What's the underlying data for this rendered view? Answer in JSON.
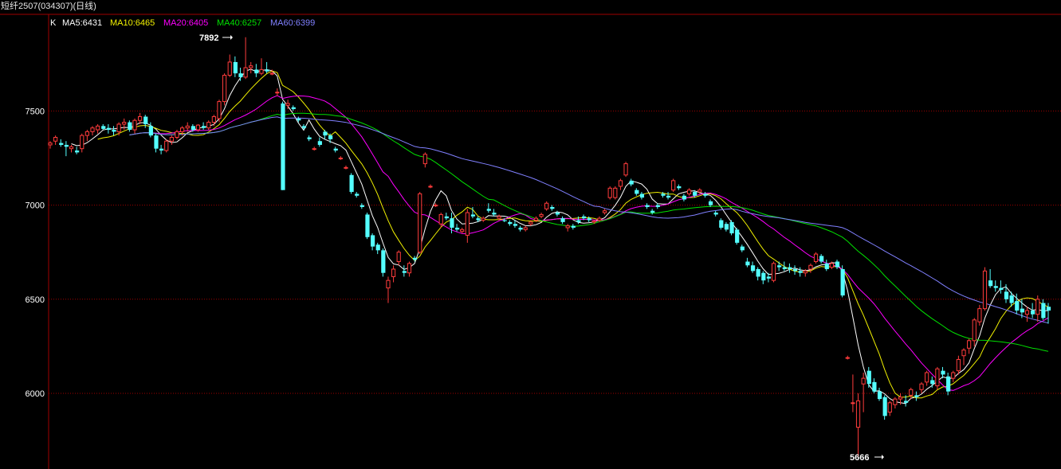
{
  "window_title": "短纤2507(034307)(日线)",
  "legend": {
    "k_label": "K",
    "items": [
      {
        "label": "MA5:6431",
        "color": "#ffffff"
      },
      {
        "label": "MA10:6465",
        "color": "#f0f000"
      },
      {
        "label": "MA20:6405",
        "color": "#ff00ff"
      },
      {
        "label": "MA40:6257",
        "color": "#00e000"
      },
      {
        "label": "MA60:6399",
        "color": "#8080ff"
      }
    ]
  },
  "colors": {
    "up": "#ff3c3c",
    "down": "#54ffff",
    "grid": "#a00000",
    "axis": "#a00000"
  },
  "annotations": {
    "high_label": "7892",
    "low_label": "5666"
  },
  "chart_data": {
    "type": "candlestick",
    "title": "短纤2507(034307)(日线)",
    "y_ticks": [
      6000,
      6500,
      7000,
      7500
    ],
    "ylim": [
      5650,
      7980
    ],
    "grid": true,
    "high": 7892,
    "low": 5666,
    "ma_last": {
      "MA5": 6431,
      "MA10": 6465,
      "MA20": 6405,
      "MA40": 6257,
      "MA60": 6399
    },
    "candles": [
      [
        7320,
        7340,
        7300,
        7330
      ],
      [
        7340,
        7370,
        7320,
        7360
      ],
      [
        7330,
        7350,
        7310,
        7320
      ],
      [
        7320,
        7340,
        7260,
        7310
      ],
      [
        7300,
        7320,
        7280,
        7310
      ],
      [
        7290,
        7310,
        7270,
        7280
      ],
      [
        7300,
        7380,
        7280,
        7370
      ],
      [
        7370,
        7400,
        7340,
        7390
      ],
      [
        7390,
        7420,
        7370,
        7410
      ],
      [
        7400,
        7430,
        7380,
        7420
      ],
      [
        7420,
        7430,
        7400,
        7405
      ],
      [
        7410,
        7430,
        7380,
        7400
      ],
      [
        7400,
        7420,
        7370,
        7390
      ],
      [
        7390,
        7440,
        7370,
        7430
      ],
      [
        7430,
        7460,
        7400,
        7440
      ],
      [
        7440,
        7450,
        7390,
        7400
      ],
      [
        7400,
        7460,
        7380,
        7450
      ],
      [
        7450,
        7490,
        7430,
        7470
      ],
      [
        7470,
        7480,
        7410,
        7430
      ],
      [
        7420,
        7440,
        7360,
        7370
      ],
      [
        7370,
        7380,
        7280,
        7300
      ],
      [
        7300,
        7320,
        7270,
        7290
      ],
      [
        7290,
        7350,
        7280,
        7340
      ],
      [
        7340,
        7370,
        7320,
        7360
      ],
      [
        7360,
        7400,
        7350,
        7390
      ],
      [
        7390,
        7420,
        7370,
        7410
      ],
      [
        7410,
        7440,
        7390,
        7420
      ],
      [
        7420,
        7430,
        7390,
        7400
      ],
      [
        7400,
        7430,
        7390,
        7425
      ],
      [
        7420,
        7440,
        7400,
        7410
      ],
      [
        7410,
        7450,
        7400,
        7440
      ],
      [
        7440,
        7480,
        7420,
        7470
      ],
      [
        7460,
        7560,
        7440,
        7550
      ],
      [
        7550,
        7700,
        7530,
        7690
      ],
      [
        7690,
        7800,
        7680,
        7760
      ],
      [
        7760,
        7790,
        7680,
        7700
      ],
      [
        7700,
        7730,
        7660,
        7680
      ],
      [
        7680,
        7892,
        7670,
        7730
      ],
      [
        7730,
        7760,
        7700,
        7740
      ],
      [
        7720,
        7750,
        7680,
        7700
      ],
      [
        7700,
        7780,
        7690,
        7720
      ],
      [
        7720,
        7760,
        7700,
        7710
      ],
      [
        7700,
        7720,
        7690,
        7700
      ],
      [
        7600,
        7620,
        7580,
        7600
      ],
      [
        7540,
        7550,
        7080,
        7080
      ],
      [
        7530,
        7560,
        7510,
        7540
      ],
      [
        7520,
        7530,
        7500,
        7510
      ],
      [
        7460,
        7470,
        7440,
        7450
      ],
      [
        7420,
        7430,
        7400,
        7410
      ],
      [
        7360,
        7370,
        7340,
        7350
      ],
      [
        7300,
        7310,
        7290,
        7300
      ],
      [
        7340,
        7360,
        7310,
        7320
      ],
      [
        7390,
        7400,
        7350,
        7370
      ],
      [
        7370,
        7380,
        7330,
        7350
      ],
      [
        7300,
        7310,
        7280,
        7290
      ],
      [
        7250,
        7260,
        7240,
        7250
      ],
      [
        7200,
        7210,
        7190,
        7200
      ],
      [
        7160,
        7170,
        7060,
        7070
      ],
      [
        7060,
        7070,
        7040,
        7050
      ],
      [
        7000,
        7010,
        6980,
        6990
      ],
      [
        6950,
        6960,
        6820,
        6830
      ],
      [
        6840,
        6850,
        6760,
        6780
      ],
      [
        6790,
        6800,
        6740,
        6760
      ],
      [
        6760,
        6770,
        6620,
        6640
      ],
      [
        6560,
        6620,
        6480,
        6600
      ],
      [
        6620,
        6680,
        6590,
        6660
      ],
      [
        6700,
        6760,
        6680,
        6750
      ],
      [
        6650,
        6680,
        6620,
        6640
      ],
      [
        6640,
        6700,
        6620,
        6690
      ],
      [
        6720,
        6730,
        6700,
        6710
      ],
      [
        6750,
        7070,
        6740,
        7060
      ],
      [
        7220,
        7280,
        7200,
        7270
      ],
      [
        7100,
        7110,
        7090,
        7100
      ],
      [
        7000,
        7010,
        6990,
        7000
      ],
      [
        6900,
        6960,
        6880,
        6950
      ],
      [
        6940,
        6960,
        6920,
        6930
      ],
      [
        6930,
        6960,
        6850,
        6880
      ],
      [
        6880,
        6900,
        6860,
        6870
      ],
      [
        6860,
        6880,
        6850,
        6870
      ],
      [
        6840,
        6980,
        6800,
        6960
      ],
      [
        6950,
        6990,
        6930,
        6940
      ],
      [
        6930,
        6940,
        6910,
        6920
      ],
      [
        6920,
        6940,
        6910,
        6930
      ],
      [
        6980,
        7010,
        6960,
        6970
      ],
      [
        6960,
        6980,
        6940,
        6950
      ],
      [
        6930,
        6950,
        6920,
        6940
      ],
      [
        6920,
        6930,
        6910,
        6915
      ],
      [
        6910,
        6920,
        6890,
        6900
      ],
      [
        6900,
        6920,
        6880,
        6890
      ],
      [
        6880,
        6890,
        6860,
        6870
      ],
      [
        6870,
        6890,
        6860,
        6880
      ],
      [
        6900,
        6920,
        6890,
        6910
      ],
      [
        6920,
        6940,
        6910,
        6930
      ],
      [
        6940,
        6960,
        6930,
        6950
      ],
      [
        6980,
        7020,
        6970,
        7010
      ],
      [
        6990,
        7000,
        6970,
        6980
      ],
      [
        6960,
        6970,
        6940,
        6950
      ],
      [
        6930,
        6940,
        6900,
        6910
      ],
      [
        6880,
        6900,
        6860,
        6890
      ],
      [
        6890,
        6900,
        6870,
        6880
      ],
      [
        6920,
        6940,
        6900,
        6910
      ],
      [
        6940,
        6950,
        6920,
        6930
      ],
      [
        6930,
        6940,
        6910,
        6920
      ],
      [
        6910,
        6920,
        6900,
        6915
      ],
      [
        6920,
        6940,
        6910,
        6930
      ],
      [
        6960,
        6980,
        6950,
        6970
      ],
      [
        7040,
        7100,
        7030,
        7090
      ],
      [
        7040,
        7100,
        7030,
        7090
      ],
      [
        7100,
        7140,
        7080,
        7130
      ],
      [
        7160,
        7230,
        7150,
        7220
      ],
      [
        7130,
        7140,
        7100,
        7110
      ],
      [
        7080,
        7090,
        7050,
        7060
      ],
      [
        7060,
        7070,
        7030,
        7040
      ],
      [
        7000,
        7010,
        6980,
        6990
      ],
      [
        6970,
        6980,
        6950,
        6960
      ],
      [
        7000,
        7010,
        6980,
        6990
      ],
      [
        7060,
        7070,
        7040,
        7050
      ],
      [
        7050,
        7070,
        7030,
        7040
      ],
      [
        7080,
        7140,
        7070,
        7130
      ],
      [
        7100,
        7110,
        7080,
        7090
      ],
      [
        7050,
        7060,
        7020,
        7030
      ],
      [
        7060,
        7090,
        7050,
        7080
      ],
      [
        7070,
        7080,
        7040,
        7050
      ],
      [
        7070,
        7090,
        7060,
        7080
      ],
      [
        7060,
        7070,
        7040,
        7050
      ],
      [
        7020,
        7030,
        6990,
        7000
      ],
      [
        6960,
        6970,
        6940,
        6950
      ],
      [
        6920,
        6930,
        6870,
        6880
      ],
      [
        6900,
        6910,
        6860,
        6870
      ],
      [
        6910,
        6920,
        6840,
        6850
      ],
      [
        6870,
        6880,
        6790,
        6800
      ],
      [
        6780,
        6790,
        6750,
        6760
      ],
      [
        6700,
        6720,
        6670,
        6680
      ],
      [
        6680,
        6700,
        6640,
        6650
      ],
      [
        6660,
        6670,
        6600,
        6620
      ],
      [
        6640,
        6650,
        6580,
        6600
      ],
      [
        6620,
        6640,
        6590,
        6610
      ],
      [
        6600,
        6700,
        6590,
        6690
      ],
      [
        6680,
        6700,
        6650,
        6670
      ],
      [
        6670,
        6700,
        6650,
        6660
      ],
      [
        6670,
        6690,
        6640,
        6660
      ],
      [
        6660,
        6680,
        6630,
        6650
      ],
      [
        6650,
        6670,
        6620,
        6640
      ],
      [
        6640,
        6660,
        6620,
        6650
      ],
      [
        6660,
        6690,
        6640,
        6680
      ],
      [
        6700,
        6750,
        6690,
        6740
      ],
      [
        6730,
        6740,
        6690,
        6700
      ],
      [
        6690,
        6710,
        6650,
        6660
      ],
      [
        6670,
        6700,
        6660,
        6690
      ],
      [
        6700,
        6710,
        6660,
        6670
      ],
      [
        6660,
        6680,
        6510,
        6520
      ],
      [
        6190,
        6200,
        6180,
        6190
      ],
      [
        5950,
        6100,
        5900,
        5950
      ],
      [
        5820,
        6000,
        5666,
        5960
      ],
      [
        6050,
        6110,
        5900,
        6080
      ],
      [
        6120,
        6140,
        6030,
        6050
      ],
      [
        6060,
        6080,
        6000,
        6010
      ],
      [
        6010,
        6030,
        5960,
        5970
      ],
      [
        5980,
        5990,
        5860,
        5880
      ],
      [
        5900,
        5960,
        5880,
        5950
      ],
      [
        5940,
        5980,
        5920,
        5970
      ],
      [
        5970,
        6000,
        5940,
        5980
      ],
      [
        5960,
        5990,
        5930,
        5950
      ],
      [
        5990,
        6030,
        5970,
        6020
      ],
      [
        5990,
        6010,
        5960,
        5980
      ],
      [
        6020,
        6060,
        6000,
        6050
      ],
      [
        6060,
        6120,
        6040,
        6110
      ],
      [
        6070,
        6090,
        6030,
        6050
      ],
      [
        6040,
        6140,
        6020,
        6130
      ],
      [
        6120,
        6140,
        6080,
        6100
      ],
      [
        6090,
        6110,
        5990,
        6010
      ],
      [
        6080,
        6120,
        6060,
        6110
      ],
      [
        6120,
        6200,
        6100,
        6180
      ],
      [
        6200,
        6240,
        6150,
        6230
      ],
      [
        6240,
        6290,
        6210,
        6280
      ],
      [
        6280,
        6400,
        6250,
        6390
      ],
      [
        6380,
        6470,
        6360,
        6450
      ],
      [
        6450,
        6670,
        6440,
        6650
      ],
      [
        6600,
        6660,
        6560,
        6570
      ],
      [
        6570,
        6600,
        6540,
        6560
      ],
      [
        6560,
        6600,
        6530,
        6550
      ],
      [
        6540,
        6580,
        6480,
        6500
      ],
      [
        6520,
        6540,
        6460,
        6480
      ],
      [
        6490,
        6530,
        6420,
        6440
      ],
      [
        6450,
        6500,
        6400,
        6430
      ],
      [
        6420,
        6460,
        6380,
        6440
      ],
      [
        6440,
        6480,
        6400,
        6420
      ],
      [
        6420,
        6520,
        6380,
        6500
      ],
      [
        6480,
        6500,
        6390,
        6400
      ],
      [
        6460,
        6480,
        6370,
        6440
      ]
    ]
  }
}
